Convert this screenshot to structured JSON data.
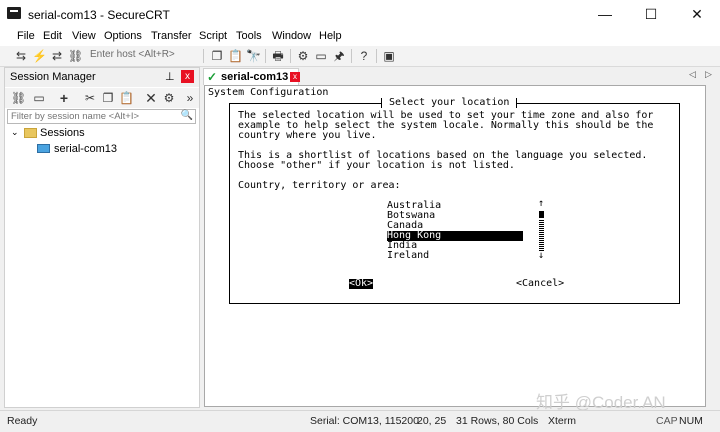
{
  "window": {
    "title": "serial-com13 - SecureCRT",
    "minimize": "—",
    "maximize": "☐",
    "close": "✕"
  },
  "menu": [
    "File",
    "Edit",
    "View",
    "Options",
    "Transfer",
    "Script",
    "Tools",
    "Window",
    "Help"
  ],
  "toolbar": {
    "quick_connect_placeholder": "Enter host <Alt+R>"
  },
  "session_manager": {
    "title": "Session Manager",
    "pin": "📌",
    "close": "x",
    "search_placeholder": "Filter by session name <Alt+I>",
    "tree": {
      "folder": "Sessions",
      "session": "serial-com13",
      "expander": "⌄"
    }
  },
  "tab": {
    "label": "serial-com13",
    "close": "x"
  },
  "terminal": {
    "header": "System Configuration",
    "dialog_title": " Select your location ",
    "body_lines": [
      "The selected location will be used to set your time zone and also for",
      "example to help select the system locale. Normally this should be the",
      "country where you live.",
      "",
      "This is a shortlist of locations based on the language you selected.",
      "Choose \"other\" if your location is not listed.",
      "",
      "Country, territory or area:"
    ],
    "locations": [
      "Australia",
      "Botswana",
      "Canada",
      "Hong Kong",
      "India",
      "Ireland"
    ],
    "selected_location": "Hong Kong",
    "ok": "<Ok>",
    "cancel": "<Cancel>"
  },
  "status": {
    "ready": "Ready",
    "connection": "Serial: COM13, 115200",
    "cursor": "20,  25",
    "size": "31 Rows, 80 Cols",
    "term": "Xterm",
    "cap": "CAP",
    "num": "NUM"
  },
  "watermark": "知乎 @Coder.AN"
}
